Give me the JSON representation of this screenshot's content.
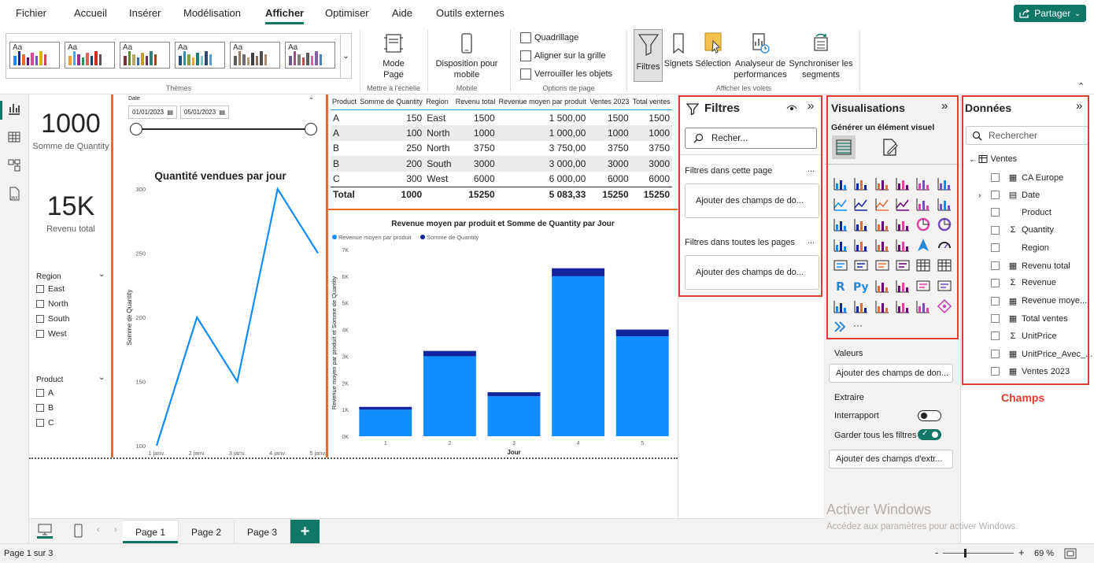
{
  "menu": {
    "items": [
      "Fichier",
      "Accueil",
      "Insérer",
      "Modélisation",
      "Afficher",
      "Optimiser",
      "Aide",
      "Outils externes"
    ],
    "active": "Afficher",
    "share_label": "Partager"
  },
  "ribbon": {
    "themes_label": "Thèmes",
    "theme_tile_text": "Aa",
    "mode_page_label": "Mode Page",
    "scale_group_label": "Mettre à l'échelle",
    "mobile_btn_label": "Disposition pour mobile",
    "mobile_group_label": "Mobile",
    "checks": [
      "Quadrillage",
      "Aligner sur la grille",
      "Verrouiller les objets"
    ],
    "page_options_label": "Options de page",
    "pane_buttons": [
      "Filtres",
      "Signets",
      "Sélection",
      "Analyseur de performances",
      "Synchroniser les segments"
    ],
    "show_panes_label": "Afficher les volets"
  },
  "cards": [
    {
      "value": "1000",
      "label": "Somme de Quantity"
    },
    {
      "value": "15K",
      "label": "Revenu total"
    }
  ],
  "date_slicer": {
    "title": "Date",
    "start": "01/01/2023",
    "end": "05/01/2023"
  },
  "region_slicer": {
    "title": "Region",
    "items": [
      "East",
      "North",
      "South",
      "West"
    ]
  },
  "product_slicer": {
    "title": "Product",
    "items": [
      "A",
      "B",
      "C"
    ]
  },
  "table": {
    "headers": [
      "Product",
      "Somme de Quantity",
      "Region",
      "Revenu total",
      "Revenue moyen par produit",
      "Ventes 2023",
      "Total ventes"
    ],
    "rows": [
      [
        "A",
        "150",
        "East",
        "1500",
        "1 500,00",
        "1500",
        "1500"
      ],
      [
        "A",
        "100",
        "North",
        "1000",
        "1 000,00",
        "1000",
        "1000"
      ],
      [
        "B",
        "250",
        "North",
        "3750",
        "3 750,00",
        "3750",
        "3750"
      ],
      [
        "B",
        "200",
        "South",
        "3000",
        "3 000,00",
        "3000",
        "3000"
      ],
      [
        "C",
        "300",
        "West",
        "6000",
        "6 000,00",
        "6000",
        "6000"
      ]
    ],
    "total": [
      "Total",
      "1000",
      "",
      "15250",
      "5 083,33",
      "15250",
      "15250"
    ]
  },
  "chart_data": [
    {
      "type": "line",
      "title": "Quantité vendues par jour",
      "xlabel": "",
      "ylabel": "Somme de Quantity",
      "x": [
        "1 janv.",
        "2 janv.",
        "3 janv.",
        "4 janv.",
        "5 janv."
      ],
      "series": [
        {
          "values": [
            100,
            200,
            150,
            300,
            250
          ]
        }
      ],
      "yticks": [
        100,
        150,
        200,
        250,
        300
      ],
      "ylim": [
        100,
        300
      ],
      "color": "#118dff"
    },
    {
      "type": "bar",
      "stacked": true,
      "title": "Revenue moyen par produit et Somme de Quantity par Jour",
      "xlabel": "Jour",
      "ylabel": "Revenue moyen par produit et Somme de Quantity",
      "categories": [
        "1",
        "2",
        "3",
        "4",
        "5"
      ],
      "series": [
        {
          "name": "Revenue moyen par produit",
          "values": [
            1000,
            3000,
            1500,
            6000,
            3750
          ],
          "color": "#118dff"
        },
        {
          "name": "Somme de Quantity",
          "values": [
            100,
            200,
            150,
            300,
            250
          ],
          "color": "#12239e"
        }
      ],
      "yticks": [
        "0K",
        "1K",
        "2K",
        "3K",
        "4K",
        "5K",
        "6K",
        "7K"
      ],
      "ylim": [
        0,
        7000
      ],
      "legend": "top-left"
    }
  ],
  "filters": {
    "title": "Filtres",
    "search_placeholder": "Recher...",
    "this_page": "Filtres dans cette page",
    "all_pages": "Filtres dans toutes les pages",
    "add_fields": "Ajouter des champs de do...",
    "more": "..."
  },
  "visualizations": {
    "title": "Visualisations",
    "subtitle": "Générer un élément visuel",
    "values_label": "Valeurs",
    "values_drop": "Ajouter des champs de don...",
    "extraire_label": "Extraire",
    "interrapport_label": "Interrapport",
    "keep_filters_label": "Garder tous les filtres",
    "extract_drop": "Ajouter des champs d'extr...",
    "more": "···"
  },
  "data_pane": {
    "title": "Données",
    "search_placeholder": "Rechercher",
    "table_name": "Ventes",
    "fields": [
      {
        "name": "CA Europe",
        "icon": "calc"
      },
      {
        "name": "Date",
        "icon": "table"
      },
      {
        "name": "Product",
        "icon": ""
      },
      {
        "name": "Quantity",
        "icon": "sigma"
      },
      {
        "name": "Region",
        "icon": ""
      },
      {
        "name": "Revenu total",
        "icon": "calc"
      },
      {
        "name": "Revenue",
        "icon": "sigma"
      },
      {
        "name": "Revenue moye...",
        "icon": "calc"
      },
      {
        "name": "Total ventes",
        "icon": "calc"
      },
      {
        "name": "UnitPrice",
        "icon": "sigma"
      },
      {
        "name": "UnitPrice_Avec_...",
        "icon": "calc"
      },
      {
        "name": "Ventes 2023",
        "icon": "calc"
      }
    ],
    "annotation": "Champs"
  },
  "watermark": {
    "title": "Activer Windows",
    "sub": "Accédez aux paramètres pour activer Windows."
  },
  "tabs": [
    "Page 1",
    "Page 2",
    "Page 3"
  ],
  "add_tab": "+",
  "status": {
    "page_info": "Page 1 sur 3",
    "zoom": "69 %",
    "minus": "-",
    "plus": "+"
  },
  "colors": {
    "accent": "#117865",
    "highlight_red": "#e03c31",
    "visual_border": "#e46c2f",
    "series1": "#118dff",
    "series2": "#12239e"
  }
}
